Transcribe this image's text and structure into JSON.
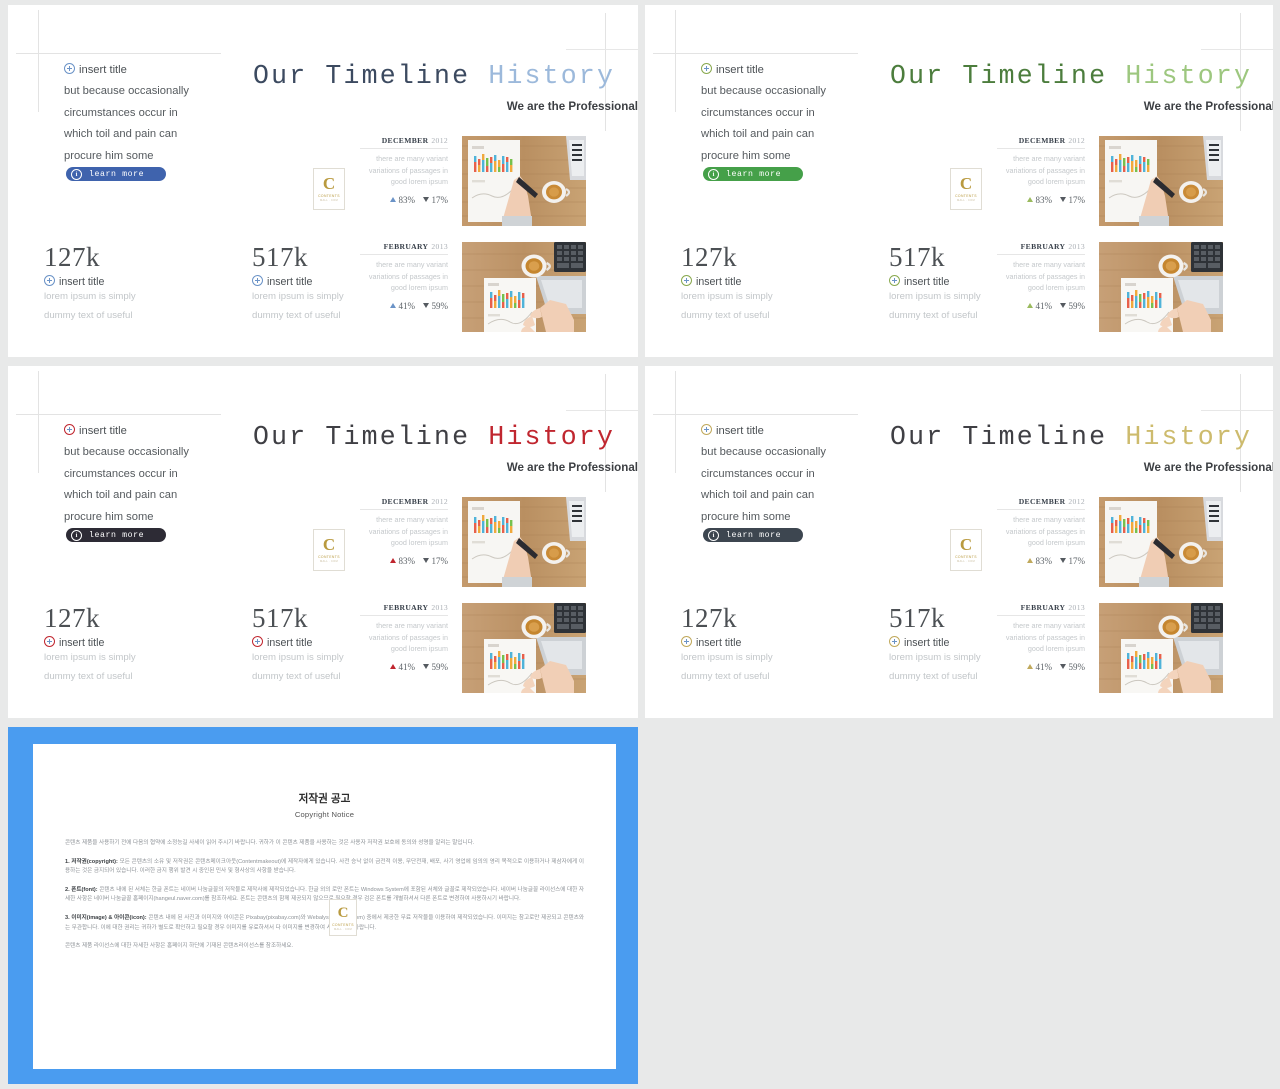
{
  "canvas": {
    "background": "#e8e9e9"
  },
  "slides": [
    {
      "id": "slide-blue",
      "accent": "#3f63ad",
      "title_main": "Our Timeline",
      "title_accent": "History",
      "title_main_color": "#3c4a60",
      "title_accent_color": "#9cb9db",
      "subtitle": "We are the Professional",
      "bullets": [
        "insert title",
        "but because occasionally",
        "circumstances occur in",
        "which toil and pain can",
        "procure him some"
      ],
      "button_label": "learn more",
      "button_color": "#3f63ad",
      "plus_color": "#6b93c7",
      "tri_up_color": "#6b93c7",
      "stats": [
        {
          "number": "127k",
          "title": "insert title",
          "line1": "lorem ipsum is simply",
          "line2": "dummy text of useful"
        },
        {
          "number": "517k",
          "title": "insert title",
          "line1": "lorem ipsum is simply",
          "line2": "dummy text of useful"
        }
      ],
      "timeline": [
        {
          "month": "DECEMBER",
          "year": "2012",
          "desc": "there are many variant variations of passages in good lorem ipsum",
          "up": "83%",
          "down": "17%",
          "photo": "desk-chart-hand-pen"
        },
        {
          "month": "FEBRUARY",
          "year": "2013",
          "desc": "there are many variant variations of passages in good lorem ipsum",
          "up": "41%",
          "down": "59%",
          "photo": "desk-chart-laptop-hand"
        }
      ],
      "badge": {
        "letter": "C",
        "line1": "CONTENTS",
        "line2": "MALL . COM"
      }
    },
    {
      "id": "slide-green",
      "accent": "#45a049",
      "title_main": "Our Timeline",
      "title_accent": "History",
      "title_main_color": "#4c7d3d",
      "title_accent_color": "#9dc77f",
      "subtitle": "We are the Professional",
      "bullets": [
        "insert title",
        "but because occasionally",
        "circumstances occur in",
        "which toil and pain can",
        "procure him some"
      ],
      "button_label": "learn more",
      "button_color": "#45a049",
      "plus_color": "#89a94f",
      "tri_up_color": "#9aba5e",
      "stats": [
        {
          "number": "127k",
          "title": "insert title",
          "line1": "lorem ipsum is simply",
          "line2": "dummy text of useful"
        },
        {
          "number": "517k",
          "title": "insert title",
          "line1": "lorem ipsum is simply",
          "line2": "dummy text of useful"
        }
      ],
      "timeline": [
        {
          "month": "DECEMBER",
          "year": "2012",
          "desc": "there are many variant variations of passages in good lorem ipsum",
          "up": "83%",
          "down": "17%",
          "photo": "desk-chart-hand-pen"
        },
        {
          "month": "FEBRUARY",
          "year": "2013",
          "desc": "there are many variant variations of passages in good lorem ipsum",
          "up": "41%",
          "down": "59%",
          "photo": "desk-chart-laptop-hand"
        }
      ],
      "badge": {
        "letter": "C",
        "line1": "CONTENTS",
        "line2": "MALL . COM"
      }
    },
    {
      "id": "slide-red",
      "accent": "#2d2b35",
      "title_main": "Our Timeline",
      "title_accent": "History",
      "title_main_color": "#3f3f44",
      "title_accent_color": "#c0262f",
      "subtitle": "We are the Professional",
      "bullets": [
        "insert title",
        "but because occasionally",
        "circumstances occur in",
        "which toil and pain can",
        "procure him some"
      ],
      "button_label": "learn more",
      "button_color": "#2d2b35",
      "plus_color": "#c0262f",
      "tri_up_color": "#c0262f",
      "stats": [
        {
          "number": "127k",
          "title": "insert title",
          "line1": "lorem ipsum is simply",
          "line2": "dummy text of useful"
        },
        {
          "number": "517k",
          "title": "insert title",
          "line1": "lorem ipsum is simply",
          "line2": "dummy text of useful"
        }
      ],
      "timeline": [
        {
          "month": "DECEMBER",
          "year": "2012",
          "desc": "there are many variant variations of passages in good lorem ipsum",
          "up": "83%",
          "down": "17%",
          "photo": "desk-chart-hand-pen"
        },
        {
          "month": "FEBRUARY",
          "year": "2013",
          "desc": "there are many variant variations of passages in good lorem ipsum",
          "up": "41%",
          "down": "59%",
          "photo": "desk-chart-laptop-hand"
        }
      ],
      "badge": {
        "letter": "C",
        "line1": "CONTENTS",
        "line2": "MALL . COM"
      }
    },
    {
      "id": "slide-gold",
      "accent": "#3d4650",
      "title_main": "Our Timeline",
      "title_accent": "History",
      "title_main_color": "#3f3f44",
      "title_accent_color": "#cdbb6d",
      "subtitle": "We are the Professional",
      "bullets": [
        "insert title",
        "but because occasionally",
        "circumstances occur in",
        "which toil and pain can",
        "procure him some"
      ],
      "button_label": "learn more",
      "button_color": "#3d4650",
      "plus_color": "#c0a95c",
      "tri_up_color": "#c0a95c",
      "stats": [
        {
          "number": "127k",
          "title": "insert title",
          "line1": "lorem ipsum is simply",
          "line2": "dummy text of useful"
        },
        {
          "number": "517k",
          "title": "insert title",
          "line1": "lorem ipsum is simply",
          "line2": "dummy text of useful"
        }
      ],
      "timeline": [
        {
          "month": "DECEMBER",
          "year": "2012",
          "desc": "there are many variant variations of passages in good lorem ipsum",
          "up": "83%",
          "down": "17%",
          "photo": "desk-chart-hand-pen"
        },
        {
          "month": "FEBRUARY",
          "year": "2013",
          "desc": "there are many variant variations of passages in good lorem ipsum",
          "up": "41%",
          "down": "59%",
          "photo": "desk-chart-laptop-hand"
        }
      ],
      "badge": {
        "letter": "C",
        "line1": "CONTENTS",
        "line2": "MALL . COM"
      }
    }
  ],
  "copyright": {
    "band_color": "#4a9cf0",
    "title_ko": "저작권 공고",
    "title_en": "Copyright Notice",
    "intro": "콘텐츠 제품을 사용하기 전에 다음의 협약에 소정능길 사세이 읽어 주시기 바랍니다. 귀하가 이 콘텐츠 제품을 사용하는 것은 사용자 저작권 보호에 동의와 성명을 알리는 말입니다.",
    "p1_label": "1. 저작권(copyright):",
    "p1": " 모든 콘텐츠의 소유 및 저작권은 콘텐츠메이크아웃(Contentmakeout)에 제작자에게 있습니다. 사전 승낙 없이 금전적 이용, 무단전재, 배포, 사기 영업에 임의의 영리 목적으로 이용하거나 제삼자에게 이용하는 것은 금지되어 있습니다. 이러한 금지 행위 발견 시 중인된 민사 및 형사상의 사항을 받습니다.",
    "p2_label": "2. 폰트(font):",
    "p2": " 콘텐츠 내에 된 서체는 한글 폰트는 네이버 나눔글꼴의 저작물로 제작사에 제작되었습니다. 한글 외의 로만 폰트는 Windows System에 포함된 서체와 글꼴로 제작되었습니다. 네이버 나눔글꼴 라이선스에 대한 자세한 사항은 네이버 나눔글꼴 홈페이지(hangeul.naver.com)를 참조하세요. 폰트는 콘텐츠의 함께 제공되지 않으므로 필요할 경우 검은 폰트를 개별하셔서 다른 폰트로 변경하여 사용하시기 바랍니다.",
    "p3_label": "3. 이미지(image) & 아이콘(icon):",
    "p3": " 콘텐츠 내에 된 사진과 이미지와 아이콘은 Pixabay(pixabay.com)와 Webalys(webalys.com) 중에서 제공한 무료 저작물을 이용하여 제작되었습니다. 이미지는 참고로만 제공되고 콘텐츠와는 무관합니다. 이에 대한 권리는 귀하가 별도로 확인하고 필요할 경우 이미지를 유료하셔서 다 이미지를 변경하여 사용하시기 바랍니다.",
    "footer": "콘텐츠 제품 라이선스에 대한 자세한 사항은 홈페이지 하단에 기재된 콘텐츠라이선스를 참조하세요.",
    "logo": {
      "letter": "C",
      "line1": "CONTENTS",
      "line2": "MALL . COM"
    }
  }
}
